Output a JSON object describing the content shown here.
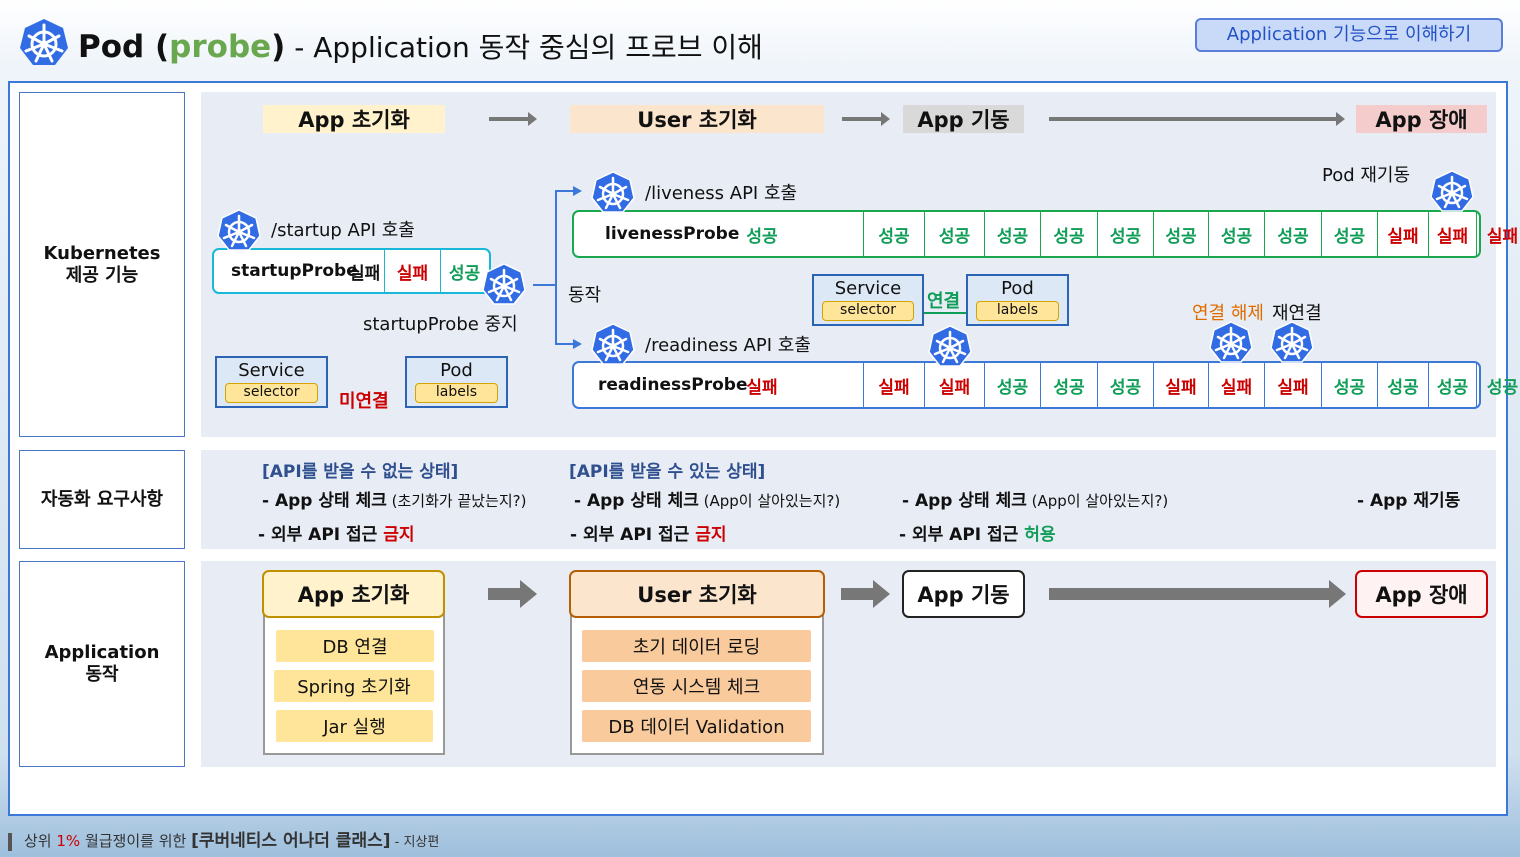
{
  "header": {
    "title_pre": "Pod (",
    "title_probe": "probe",
    "title_post": ")",
    "title_rest": " - Application 동작 중심의 프로브 이해",
    "top_button": "Application 기능으로 이해하기"
  },
  "sections": {
    "k8s": "Kubernetes 제공 기능",
    "automation": "자동화 요구사항",
    "app": "Application 동작"
  },
  "stages": [
    "App 초기화",
    "User 초기화",
    "App 기동",
    "App 장애"
  ],
  "k8s_panel": {
    "startup_api": "/startup API 호출",
    "liveness_api": "/liveness API 호출",
    "readiness_api": "/readiness API 호출",
    "startup_probe": {
      "name": "startupProbe",
      "results": [
        "실패",
        "실패",
        "성공"
      ]
    },
    "liveness_probe": {
      "name": "livenessProbe",
      "results": [
        "성공",
        "성공",
        "성공",
        "성공",
        "성공",
        "성공",
        "성공",
        "성공",
        "성공",
        "성공",
        "실패",
        "실패",
        "실패"
      ]
    },
    "readiness_probe": {
      "name": "readinessProbe",
      "results": [
        "실패",
        "실패",
        "실패",
        "성공",
        "성공",
        "성공",
        "실패",
        "실패",
        "실패",
        "성공",
        "성공",
        "성공",
        "성공"
      ]
    },
    "startup_stop": "startupProbe 중지",
    "action": "동작",
    "pod_restart": "Pod 재기동",
    "disconnect": "연결 해제",
    "reconnect": "재연결",
    "connected": "연결",
    "not_connected": "미연결",
    "service": {
      "title": "Service",
      "sub": "selector"
    },
    "pod": {
      "title": "Pod",
      "sub": "labels"
    }
  },
  "automation": {
    "h1": "[API를 받을 수 없는 상태]",
    "h2": "[API를 받을 수 있는 상태]",
    "c1_line1_b": "- App 상태 체크",
    "c1_line1_n": " (초기화가 끝났는지?)",
    "c1_line2": "- 외부 API 접근 ",
    "c1_line2_s": "금지",
    "c2_line1_b": "- App 상태 체크",
    "c2_line1_n": " (App이 살아있는지?)",
    "c2_line2": "- 외부 API 접근 ",
    "c2_line2_s": "금지",
    "c3_line1_b": "- App 상태 체크",
    "c3_line1_n": " (App이 살아있는지?)",
    "c3_line2": "- 외부 API 접근 ",
    "c3_line2_s": "허용",
    "c4_line1": "- App 재기동"
  },
  "app_panel": {
    "app_init_items": [
      "DB 연결",
      "Spring 초기화",
      "Jar 실행"
    ],
    "user_init_items": [
      "초기 데이터 로딩",
      "연동 시스템 체크",
      "DB 데이터 Validation"
    ]
  },
  "footer": {
    "pre": "상위 ",
    "pct": "1%",
    "mid": " 월급쟁이를 위한 ",
    "bold": "[쿠버네티스 어나더 클래스]",
    "post": " - 지상편"
  },
  "colors": {
    "accent_blue": "#3c78d8",
    "success": "#0f9d58",
    "fail": "#cc0000",
    "probe_green": "#1aa84f",
    "startup_cyan": "#19b7d8",
    "stage_init": "#fff2cc",
    "stage_user": "#fce5cd",
    "stage_run": "#d9d9d9",
    "stage_fail": "#f4cccc"
  }
}
